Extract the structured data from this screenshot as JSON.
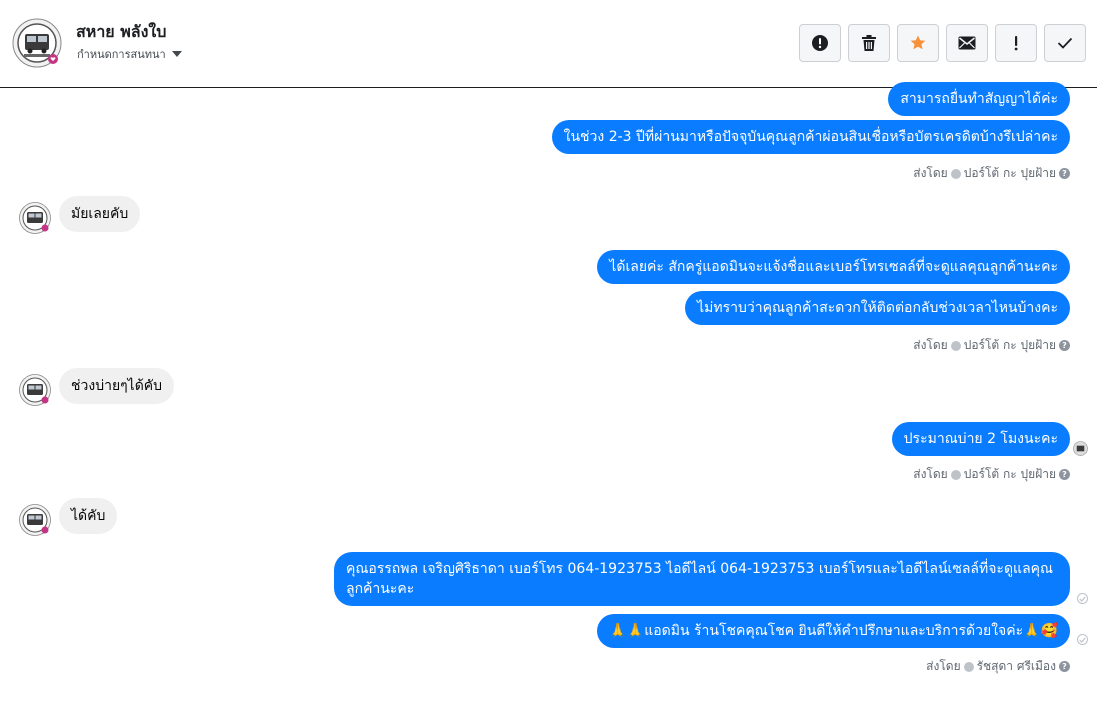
{
  "header": {
    "name": "สหาย พลังใบ",
    "assign_label": "กำหนดการสนทนา"
  },
  "actions": [
    {
      "name": "alert-icon",
      "label": "!"
    },
    {
      "name": "trash-icon",
      "label": "trash"
    },
    {
      "name": "star-icon",
      "label": "star"
    },
    {
      "name": "mail-icon",
      "label": "mail"
    },
    {
      "name": "exclamation-icon",
      "label": "!"
    },
    {
      "name": "check-icon",
      "label": "check"
    }
  ],
  "colors": {
    "outgoing": "#0a7cff",
    "incoming": "#f0f0f0",
    "star": "#f7923a"
  },
  "messages": {
    "out1": "สามารถยื่นทำสัญญาได้ค่ะ",
    "out2": "ในช่วง 2-3 ปีที่ผ่านมาหรือปัจจุบันคุณลูกค้าผ่อนสินเชื่อหรือบัตรเครดิตบ้างรึเปล่าคะ",
    "in1": "มัยเลยคับ",
    "out3": "ได้เลยค่ะ สักครู่แอดมินจะแจ้งชื่อและเบอร์โทรเซลล์ที่จะดูแลคุณลูกค้านะคะ",
    "out4": "ไม่ทราบว่าคุณลูกค้าสะดวกให้ติดต่อกลับช่วงเวลาไหนบ้างคะ",
    "in2": "ช่วงบ่ายๆได้คับ",
    "out5": "ประมาณบ่าย 2 โมงนะคะ",
    "in3": "ได้คับ",
    "out6": "คุณอรรถพล เจริญศิริธาดา      เบอร์โทร 064-1923753 ไอดีไลน์ 064-1923753  เบอร์โทรและไอดีไลน์เซลล์ที่จะดูแลคุณลูกค้านะคะ",
    "out7": "🙏🙏แอดมิน ร้านโชคคุณโชค ยินดีให้คำปรึกษาและบริการด้วยใจค่ะ🙏🥰"
  },
  "sent_by": {
    "prefix": "ส่งโดย",
    "agent1": "ปอร์โต้ กะ ปุยฝ้าย",
    "agent2": "รัชสุดา ศรีเมือง"
  }
}
